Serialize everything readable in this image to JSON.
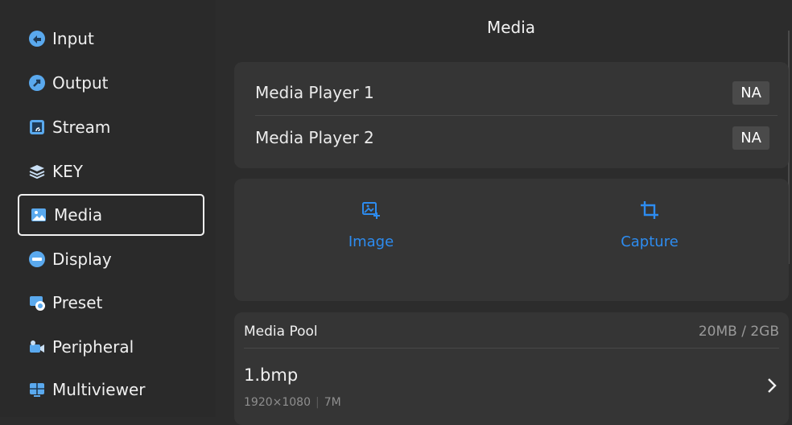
{
  "sidebar": {
    "items": [
      {
        "label": "Input",
        "icon": "input-icon"
      },
      {
        "label": "Output",
        "icon": "output-icon"
      },
      {
        "label": "Stream",
        "icon": "stream-icon"
      },
      {
        "label": "KEY",
        "icon": "layers-icon"
      },
      {
        "label": "Media",
        "icon": "image-icon",
        "active": true
      },
      {
        "label": "Display",
        "icon": "display-icon"
      },
      {
        "label": "Preset",
        "icon": "preset-icon"
      },
      {
        "label": "Peripheral",
        "icon": "camera-icon"
      },
      {
        "label": "Multiviewer",
        "icon": "multiviewer-icon"
      }
    ]
  },
  "header": {
    "title": "Media"
  },
  "players": [
    {
      "label": "Media Player 1",
      "status": "NA"
    },
    {
      "label": "Media Player 2",
      "status": "NA"
    }
  ],
  "actions": [
    {
      "label": "Image",
      "icon": "image-add-icon"
    },
    {
      "label": "Capture",
      "icon": "crop-icon"
    }
  ],
  "pool": {
    "title": "Media Pool",
    "usage": "20MB / 2GB",
    "items": [
      {
        "name": "1.bmp",
        "resolution": "1920×1080",
        "size": "7M"
      }
    ]
  },
  "colors": {
    "accent": "#2d8cf0",
    "background": "#2c2c2c",
    "card": "#353535"
  }
}
